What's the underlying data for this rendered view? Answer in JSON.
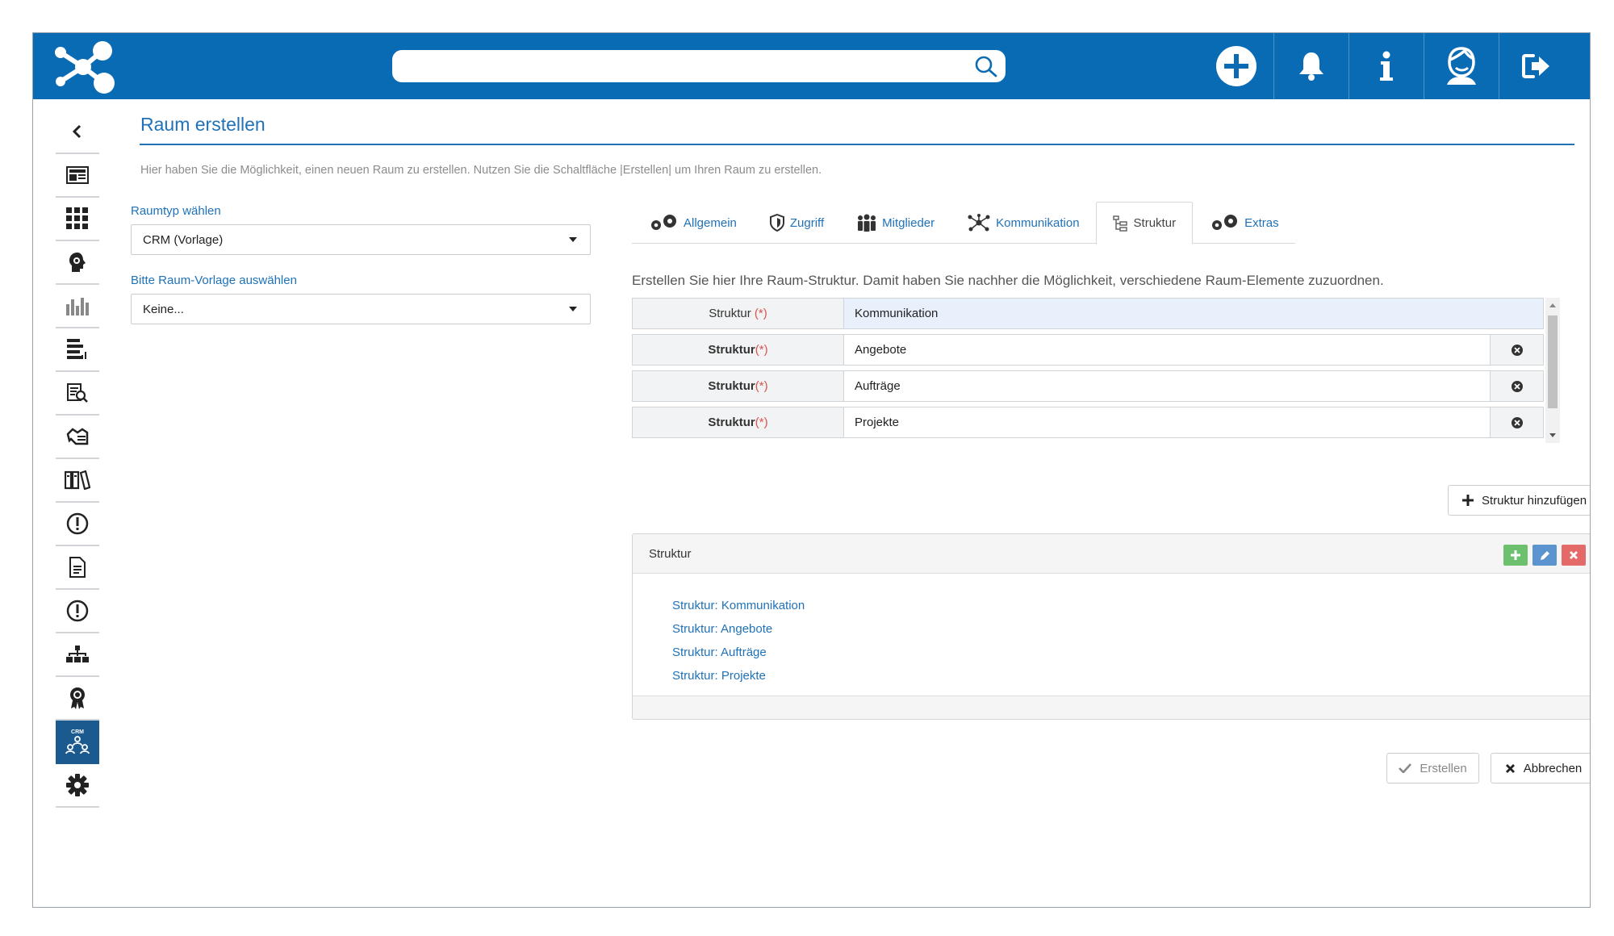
{
  "header": {
    "search_placeholder": ""
  },
  "page": {
    "title": "Raum erstellen",
    "intro": "Hier haben Sie die Möglichkeit, einen neuen Raum zu erstellen. Nutzen Sie die Schaltfläche |Erstellen| um Ihren Raum zu erstellen."
  },
  "form": {
    "room_type_label": "Raumtyp wählen",
    "room_type_value": "CRM (Vorlage)",
    "template_label": "Bitte Raum-Vorlage auswählen",
    "template_value": "Keine..."
  },
  "tabs": [
    {
      "label": "Allgemein",
      "icon": "gears-icon"
    },
    {
      "label": "Zugriff",
      "icon": "shield-icon"
    },
    {
      "label": "Mitglieder",
      "icon": "members-icon"
    },
    {
      "label": "Kommunikation",
      "icon": "network-icon"
    },
    {
      "label": "Struktur",
      "icon": "tree-icon"
    },
    {
      "label": "Extras",
      "icon": "gears-icon"
    }
  ],
  "active_tab": "Struktur",
  "structure": {
    "description": "Erstellen Sie hier Ihre Raum-Struktur. Damit haben Sie nachher die Möglichkeit, verschiedene Raum-Elemente zuzuordnen.",
    "rows": [
      {
        "label": "Struktur",
        "required": "(*)",
        "value": "Kommunikation",
        "removable": false
      },
      {
        "label": "Struktur",
        "required": "(*)",
        "value": "Angebote",
        "removable": true
      },
      {
        "label": "Struktur",
        "required": "(*)",
        "value": "Aufträge",
        "removable": true
      },
      {
        "label": "Struktur",
        "required": "(*)",
        "value": "Projekte",
        "removable": true
      }
    ],
    "add_button": "Struktur hinzufügen"
  },
  "panel": {
    "title": "Struktur",
    "items": [
      "Struktur: Kommunikation",
      "Struktur: Angebote",
      "Struktur: Aufträge",
      "Struktur: Projekte"
    ]
  },
  "actions": {
    "create": "Erstellen",
    "cancel": "Abbrechen"
  },
  "colors": {
    "brand": "#0a6bb5",
    "link": "#1f72b8",
    "required": "#d9534f"
  }
}
